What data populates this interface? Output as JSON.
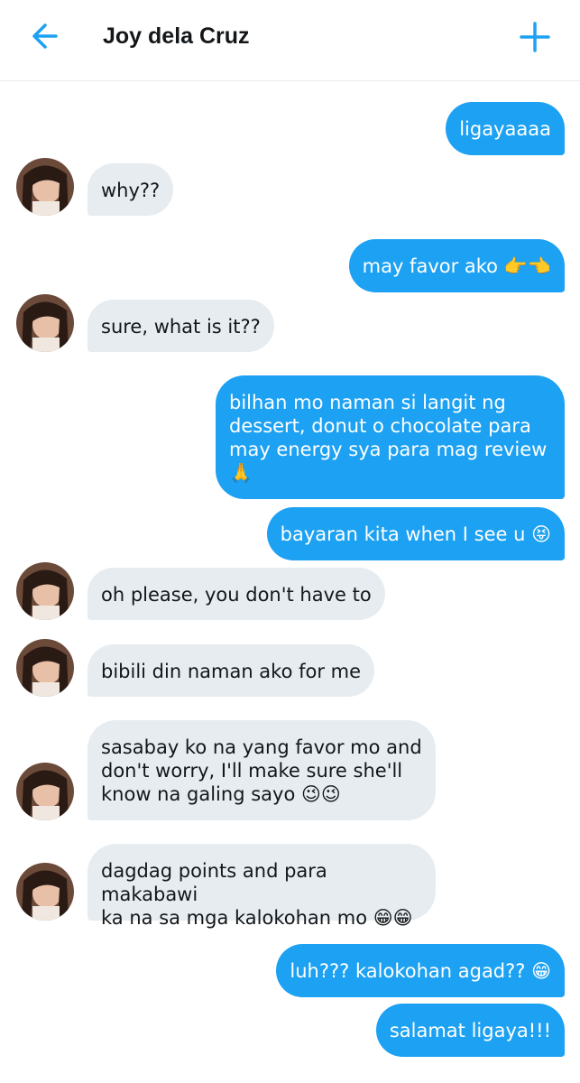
{
  "header": {
    "title": "Joy dela Cruz",
    "back_icon": "arrow-left-icon",
    "new_icon": "plus-icon"
  },
  "colors": {
    "accent": "#1da1f2",
    "received_bubble": "#e6ecf0"
  },
  "messages": [
    {
      "from": "me",
      "text": "ligayaaaa"
    },
    {
      "from": "them",
      "text": "why??"
    },
    {
      "from": "me",
      "text": "may favor ako 👉👈"
    },
    {
      "from": "them",
      "text": "sure, what is it??"
    },
    {
      "from": "me",
      "text": "bilhan mo naman si langit ng\ndessert, donut o chocolate para\nmay energy sya para mag review\n🙏"
    },
    {
      "from": "me",
      "text": "bayaran kita when I see u 😝"
    },
    {
      "from": "them",
      "text": "oh please, you don't have to"
    },
    {
      "from": "them",
      "text": "bibili din naman ako for me"
    },
    {
      "from": "them",
      "text": "sasabay ko na yang favor mo and\ndon't worry, I'll make sure she'll\nknow na galing sayo 😉😉"
    },
    {
      "from": "them",
      "text": "dagdag points and para makabawi\nka na sa mga kalokohan mo 😁😁"
    },
    {
      "from": "me",
      "text": "luh??? kalokohan agad?? 😁"
    },
    {
      "from": "me",
      "text": "salamat ligaya!!!"
    }
  ]
}
